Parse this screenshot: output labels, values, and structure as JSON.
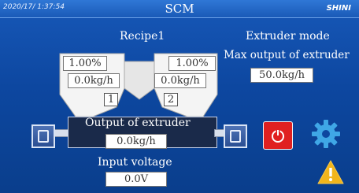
{
  "header": {
    "datetime": "2020/17/ 1:37:54",
    "title": "SCM",
    "brand": "SHINI"
  },
  "recipe": {
    "label": "Recipe1",
    "hoppers": [
      {
        "number": "1",
        "percent": "1.00%",
        "rate": "0.0kg/h"
      },
      {
        "number": "2",
        "percent": "1.00%",
        "rate": "0.0kg/h"
      }
    ]
  },
  "extruder_mode": {
    "label": "Extruder mode",
    "max_output_label": "Max output of extruder",
    "max_output_value": "50.0kg/h"
  },
  "extruder": {
    "output_label": "Output of extruder",
    "output_value": "0.0kg/h"
  },
  "voltage": {
    "label": "Input voltage",
    "value": "0.0V"
  },
  "icons": {
    "power": "power-icon",
    "settings": "gear-icon",
    "alarm": "warning-icon"
  },
  "colors": {
    "background": "#0d47a0",
    "power_button": "#e02020",
    "gear": "#3fa7e6",
    "warning": "#f2b51c"
  }
}
